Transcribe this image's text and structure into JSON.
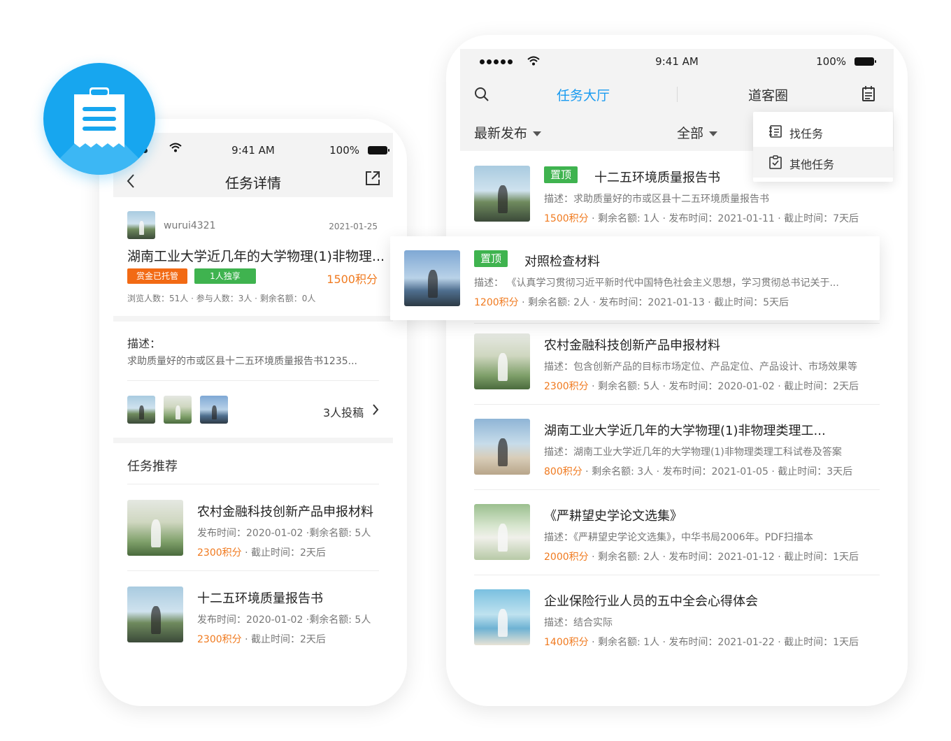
{
  "left_phone": {
    "status": {
      "time": "9:41 AM",
      "battery": "100%"
    },
    "nav": {
      "title": "任务详情"
    },
    "task": {
      "username": "wurui4321",
      "date": "2021-01-25",
      "title": "湖南工业大学近几年的大学物理(1)非物理...",
      "tags": [
        "赏金已托管",
        "1人独享"
      ],
      "points": "1500积分",
      "stats": "浏览人数：51人 · 参与人数：3人 · 剩余名额：0人"
    },
    "description": {
      "label": "描述：",
      "text": "求助质量好的市或区县十二五环境质量报告书1235..."
    },
    "submissions": "3人投稿",
    "recommend": {
      "title": "任务推荐",
      "items": [
        {
          "title": "农村金融科技创新产品申报材料",
          "meta": "发布时间：2020-01-02 ·剩余名额: 5人",
          "points": "2300积分",
          "deadline": " · 截止时间：2天后"
        },
        {
          "title": "十二五环境质量报告书",
          "meta": "发布时间：2020-01-02 ·剩余名额: 5人",
          "points": "2300积分",
          "deadline": " · 截止时间：2天后"
        }
      ]
    }
  },
  "right_phone": {
    "status": {
      "time": "9:41 AM",
      "battery": "100%"
    },
    "tabs": [
      "任务大厅",
      "道客圈"
    ],
    "filters": [
      "最新发布",
      "全部"
    ],
    "dropdown": [
      "找任务",
      "其他任务"
    ],
    "pinned_label": "置顶",
    "items": [
      {
        "title": "十二五环境质量报告书",
        "pinned": true,
        "desc": "描述：求助质量好的市或区县十二五环境质量报告书",
        "points": "1500积分",
        "meta": " · 剩余名额: 1人 · 发布时间：2021-01-11 · 截止时间：7天后"
      },
      {
        "title": "农村金融科技创新产品申报材料",
        "pinned": false,
        "desc": "描述：包含创新产品的目标市场定位、产品定位、产品设计、市场效果等",
        "points": "2300积分",
        "meta": " · 剩余名额: 5人 · 发布时间：2020-01-02 · 截止时间：2天后"
      },
      {
        "title": "湖南工业大学近几年的大学物理(1)非物理类理工...",
        "pinned": false,
        "desc": "描述：湖南工业大学近几年的大学物理(1)非物理类理工科试卷及答案",
        "points": "800积分",
        "meta": " · 剩余名额: 3人 · 发布时间：2021-01-05 · 截止时间：3天后"
      },
      {
        "title": "《严耕望史学论文选集》",
        "pinned": false,
        "desc": "描述：《严耕望史学论文选集》，中华书局2006年。PDF扫描本",
        "points": "2000积分",
        "meta": " · 剩余名额: 2人 · 发布时间：2021-01-12 · 截止时间：1天后"
      },
      {
        "title": "企业保险行业人员的五中全会心得体会",
        "pinned": false,
        "desc": "描述：结合实际",
        "points": "1400积分",
        "meta": " · 剩余名额: 1人 · 发布时间：2021-01-22 · 截止时间：1天后"
      }
    ]
  },
  "floating_card": {
    "pinned_label": "置顶",
    "title": "对照检查材料",
    "desc": "描述：  《认真学习贯彻习近平新时代中国特色社会主义思想，学习贯彻总书记关于...",
    "points": "1200积分",
    "meta": " · 剩余名额: 2人 · 发布时间：2021-01-13 · 截止时间：5天后"
  },
  "colors": {
    "accent": "#1a9bf0",
    "orange": "#f07a1f",
    "green": "#3fb34f",
    "badge_blue": "#17a6ef"
  }
}
